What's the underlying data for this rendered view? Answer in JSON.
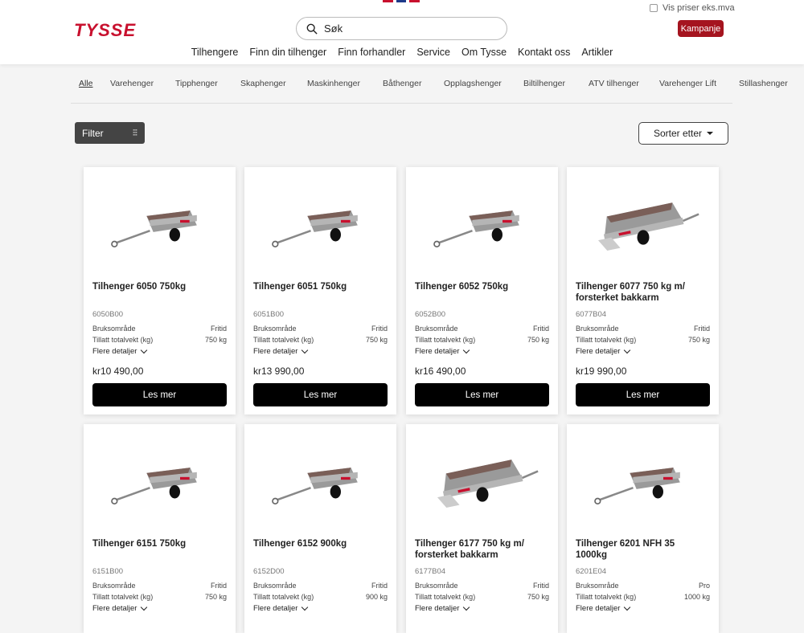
{
  "header": {
    "logo": "TYSSE",
    "search_placeholder": "Søk",
    "vat_label": "Vis priser eks.mva",
    "campaign_label": "Kampanje",
    "nav": [
      "Tilhengere",
      "Finn din tilhenger",
      "Finn forhandler",
      "Service",
      "Om Tysse",
      "Kontakt oss",
      "Artikler"
    ]
  },
  "categories": [
    "Alle",
    "Varehenger",
    "Tipphenger",
    "Skaphenger",
    "Maskinhenger",
    "Båthenger",
    "Opplagshenger",
    "Biltilhenger",
    "ATV tilhenger",
    "Varehenger Lift",
    "Stillashenger"
  ],
  "toolbar": {
    "filter_label": "Filter",
    "sort_label": "Sorter etter"
  },
  "product_labels": {
    "usage": "Bruksområde",
    "weight": "Tillatt totalvekt (kg)",
    "details": "Flere detaljer",
    "read_more": "Les mer"
  },
  "products": [
    {
      "title": "Tilhenger 6050 750kg",
      "sku": "6050B00",
      "usage": "Fritid",
      "weight": "750 kg",
      "price": "kr10 490,00"
    },
    {
      "title": "Tilhenger 6051 750kg",
      "sku": "6051B00",
      "usage": "Fritid",
      "weight": "750 kg",
      "price": "kr13 990,00"
    },
    {
      "title": "Tilhenger 6052 750kg",
      "sku": "6052B00",
      "usage": "Fritid",
      "weight": "750 kg",
      "price": "kr16 490,00"
    },
    {
      "title": "Tilhenger 6077 750 kg m/ forsterket bakkarm",
      "sku": "6077B04",
      "usage": "Fritid",
      "weight": "750 kg",
      "price": "kr19 990,00"
    },
    {
      "title": "Tilhenger 6151 750kg",
      "sku": "6151B00",
      "usage": "Fritid",
      "weight": "750 kg",
      "price": ""
    },
    {
      "title": "Tilhenger 6152 900kg",
      "sku": "6152D00",
      "usage": "Fritid",
      "weight": "900 kg",
      "price": ""
    },
    {
      "title": "Tilhenger 6177 750 kg m/ forsterket bakkarm",
      "sku": "6177B04",
      "usage": "Fritid",
      "weight": "750 kg",
      "price": ""
    },
    {
      "title": "Tilhenger 6201 NFH 35 1000kg",
      "sku": "6201E04",
      "usage": "Pro",
      "weight": "1000 kg",
      "price": ""
    }
  ]
}
